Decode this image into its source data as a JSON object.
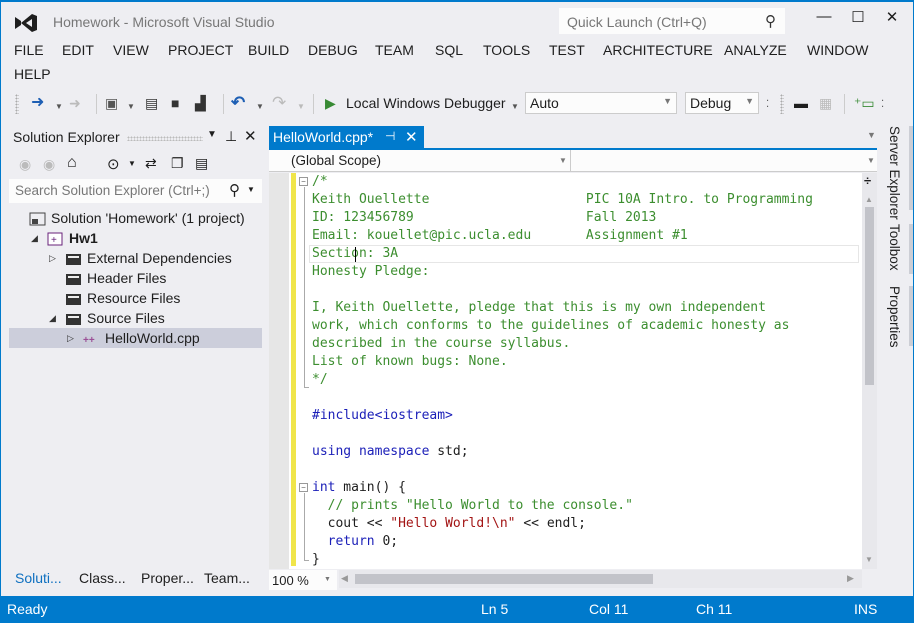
{
  "window": {
    "title": "Homework - Microsoft Visual Studio",
    "quick_launch_placeholder": "Quick Launch (Ctrl+Q)",
    "controls": {
      "minimize": "—",
      "maximize": "☐",
      "close": "✕"
    }
  },
  "menu": [
    "FILE",
    "EDIT",
    "VIEW",
    "PROJECT",
    "BUILD",
    "DEBUG",
    "TEAM",
    "SQL",
    "TOOLS",
    "TEST",
    "ARCHITECTURE",
    "ANALYZE",
    "WINDOW",
    "HELP"
  ],
  "toolbar": {
    "run_label": "Local Windows Debugger",
    "solution_platform": "Auto",
    "configuration": "Debug",
    "icons": [
      "back-icon",
      "forward-icon",
      "new-project-icon",
      "open-file-icon",
      "save-icon",
      "save-all-icon",
      "undo-icon",
      "redo-icon",
      "start-debug-icon",
      "step-icon",
      "bookmark-icon",
      "comment-icon"
    ]
  },
  "solution_explorer": {
    "title": "Solution Explorer",
    "search_placeholder": "Search Solution Explorer (Ctrl+;)",
    "tree": [
      {
        "label": "Solution 'Homework' (1 project)",
        "icon": "solution-icon",
        "level": 0,
        "expander": ""
      },
      {
        "label": "Hw1",
        "icon": "cpp-project-icon",
        "level": 1,
        "expander": "◢",
        "bold": true
      },
      {
        "label": "External Dependencies",
        "icon": "filter-folder-icon",
        "level": 2,
        "expander": "▷"
      },
      {
        "label": "Header Files",
        "icon": "filter-folder-icon",
        "level": 2,
        "expander": ""
      },
      {
        "label": "Resource Files",
        "icon": "filter-folder-icon",
        "level": 2,
        "expander": ""
      },
      {
        "label": "Source Files",
        "icon": "filter-folder-icon",
        "level": 2,
        "expander": "◢"
      },
      {
        "label": "HelloWorld.cpp",
        "icon": "cpp-file-icon",
        "level": 3,
        "expander": "▷",
        "selected": true
      }
    ],
    "bottom_tabs": [
      "Soluti...",
      "Class...",
      "Proper...",
      "Team..."
    ]
  },
  "editor": {
    "tab_label": "HelloWorld.cpp*",
    "scope": "(Global Scope)",
    "zoom": "100 %",
    "lines": [
      [
        {
          "t": "/*",
          "c": "cmt"
        }
      ],
      [
        {
          "t": "Keith Ouellette                    PIC 10A Intro. to Programming",
          "c": "cmt"
        }
      ],
      [
        {
          "t": "ID: 123456789                      Fall 2013",
          "c": "cmt"
        }
      ],
      [
        {
          "t": "Email: kouellet@pic.ucla.edu       Assignment #1",
          "c": "cmt"
        }
      ],
      [
        {
          "t": "Section: 3A",
          "c": "cmt"
        }
      ],
      [
        {
          "t": "Honesty Pledge:",
          "c": "cmt"
        }
      ],
      [
        {
          "t": "",
          "c": "cmt"
        }
      ],
      [
        {
          "t": "I, Keith Ouellette, pledge that this is my own independent",
          "c": "cmt"
        }
      ],
      [
        {
          "t": "work, which conforms to the guidelines of academic honesty as",
          "c": "cmt"
        }
      ],
      [
        {
          "t": "described in the course syllabus.",
          "c": "cmt"
        }
      ],
      [
        {
          "t": "List of known bugs: None.",
          "c": "cmt"
        }
      ],
      [
        {
          "t": "*/",
          "c": "cmt"
        }
      ],
      [
        {
          "t": "",
          "c": ""
        }
      ],
      [
        {
          "t": "#include<iostream>",
          "c": "pp"
        }
      ],
      [
        {
          "t": "",
          "c": ""
        }
      ],
      [
        {
          "t": "using namespace",
          "c": "kw"
        },
        {
          "t": " std;",
          "c": ""
        }
      ],
      [
        {
          "t": "",
          "c": ""
        }
      ],
      [
        {
          "t": "int",
          "c": "kw"
        },
        {
          "t": " main() {",
          "c": ""
        }
      ],
      [
        {
          "t": "  // prints \"Hello World to the console.\"",
          "c": "cmt"
        }
      ],
      [
        {
          "t": "  cout << ",
          "c": ""
        },
        {
          "t": "\"Hello World!\\n\"",
          "c": "str"
        },
        {
          "t": " << endl;",
          "c": ""
        }
      ],
      [
        {
          "t": "  ",
          "c": ""
        },
        {
          "t": "return",
          "c": "kw"
        },
        {
          "t": " 0;",
          "c": ""
        }
      ],
      [
        {
          "t": "}",
          "c": ""
        }
      ]
    ]
  },
  "side_tabs": [
    "Server Explorer",
    "Toolbox",
    "Properties"
  ],
  "status": {
    "text": "Ready",
    "ln": "Ln 5",
    "col": "Col 11",
    "ch": "Ch 11",
    "mode": "INS"
  }
}
